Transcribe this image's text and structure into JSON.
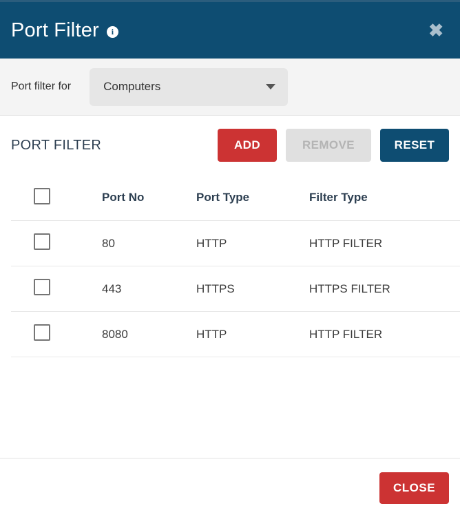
{
  "header": {
    "title": "Port Filter",
    "info_icon": "info-icon",
    "close_icon": "✖"
  },
  "filter_bar": {
    "label": "Port filter for",
    "select_value": "Computers",
    "select_options": [
      "Computers"
    ]
  },
  "section": {
    "title": "PORT FILTER",
    "buttons": {
      "add": "ADD",
      "remove": "REMOVE",
      "reset": "RESET"
    }
  },
  "table": {
    "columns": [
      "",
      "Port No",
      "Port Type",
      "Filter Type"
    ],
    "rows": [
      {
        "port_no": "80",
        "port_type": "HTTP",
        "filter_type": "HTTP FILTER"
      },
      {
        "port_no": "443",
        "port_type": "HTTPS",
        "filter_type": "HTTPS FILTER"
      },
      {
        "port_no": "8080",
        "port_type": "HTTP",
        "filter_type": "HTTP FILTER"
      }
    ]
  },
  "footer": {
    "close_label": "CLOSE"
  },
  "colors": {
    "header_blue": "#0e4d72",
    "accent_red": "#cc3333",
    "disabled_gray": "#e0e0e0",
    "filter_bar_gray": "#f4f4f4"
  }
}
